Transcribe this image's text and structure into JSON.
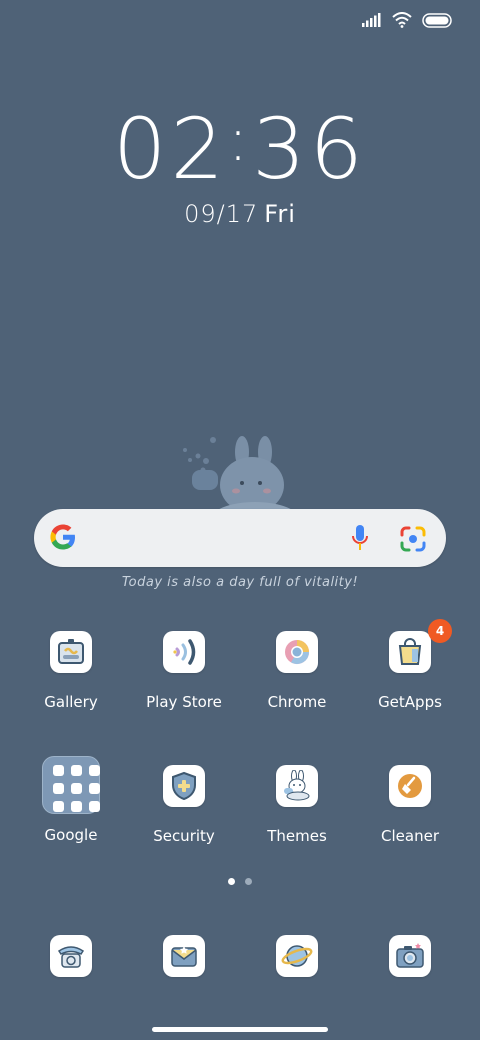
{
  "status": {
    "icons": [
      "signal-icon",
      "wifi-icon",
      "battery-icon"
    ]
  },
  "clock": {
    "hours": "02",
    "minutes": "36"
  },
  "date": {
    "day_month": "09/17",
    "weekday": "Fri"
  },
  "widget": {
    "caption": "Today is also a day full of vitality!"
  },
  "search": {
    "icons": [
      "google-logo-icon",
      "mic-icon",
      "lens-icon"
    ]
  },
  "apps": [
    {
      "label": "Gallery"
    },
    {
      "label": "Play Store"
    },
    {
      "label": "Chrome"
    },
    {
      "label": "GetApps",
      "badge": "4"
    },
    {
      "label": "Google"
    },
    {
      "label": "Security"
    },
    {
      "label": "Themes"
    },
    {
      "label": "Cleaner"
    }
  ],
  "pages": {
    "count": 2,
    "current": 1
  },
  "dock": [
    "phone-icon",
    "messages-icon",
    "browser-icon",
    "camera-icon"
  ],
  "colors": {
    "wallpaper": "#4f6277",
    "badge": "#f05a23"
  }
}
